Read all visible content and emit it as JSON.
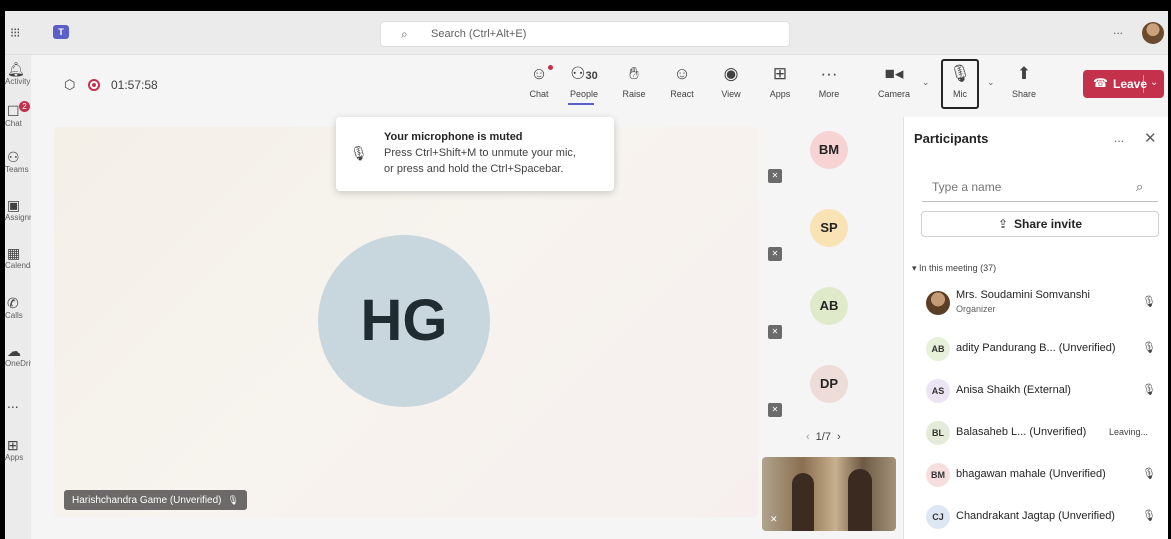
{
  "titlebar": {
    "search_placeholder": "Search (Ctrl+Alt+E)",
    "more": "..."
  },
  "rail": {
    "items": [
      {
        "label": "Activity",
        "icon": "bell-icon"
      },
      {
        "label": "Chat",
        "icon": "chat-icon",
        "badge": "2"
      },
      {
        "label": "Teams",
        "icon": "teams-icon"
      },
      {
        "label": "Assignments",
        "icon": "assignments-icon"
      },
      {
        "label": "Calendar",
        "icon": "calendar-icon"
      },
      {
        "label": "Calls",
        "icon": "phone-icon"
      },
      {
        "label": "OneDrive",
        "icon": "cloud-icon"
      },
      {
        "label": "...",
        "icon": "more-icon"
      },
      {
        "label": "Apps",
        "icon": "add-apps-icon"
      }
    ]
  },
  "toolbar": {
    "timer": "01:57:58",
    "chat": "Chat",
    "people": "People",
    "people_count": "30",
    "raise": "Raise",
    "react": "React",
    "view": "View",
    "apps": "Apps",
    "more": "More",
    "camera": "Camera",
    "mic": "Mic",
    "share": "Share",
    "leave": "Leave"
  },
  "toast": {
    "title": "Your microphone is muted",
    "line1": "Press Ctrl+Shift+M to unmute your mic,",
    "line2": "or press and hold the Ctrl+Spacebar."
  },
  "stage": {
    "initials": "HG",
    "name_tag": "Harishchandra Game (Unverified)"
  },
  "tiles": [
    {
      "initials": "BM",
      "color": "#f7d3d3"
    },
    {
      "initials": "SP",
      "color": "#f9e3b4"
    },
    {
      "initials": "AB",
      "color": "#dfeacb"
    },
    {
      "initials": "DP",
      "color": "#eddcd8"
    }
  ],
  "pager": {
    "text": "1/7"
  },
  "panel": {
    "title": "Participants",
    "more": "...",
    "search_placeholder": "Type a name",
    "share_invite": "Share invite",
    "in_meeting": "In this meeting (37)",
    "participants": [
      {
        "initials": "",
        "name": "Mrs. Soudamini Somvanshi",
        "sub": "Organizer",
        "photo": true,
        "avatar_color": "",
        "status": ""
      },
      {
        "initials": "AB",
        "name": "adity Pandurang B... (Unverified)",
        "sub": "",
        "photo": false,
        "avatar_color": "#e7f0d8",
        "status": ""
      },
      {
        "initials": "AS",
        "name": "Anisa Shaikh (External)",
        "sub": "",
        "photo": false,
        "avatar_color": "#ece3f3",
        "status": ""
      },
      {
        "initials": "BL",
        "name": "Balasaheb L... (Unverified)",
        "sub": "",
        "photo": false,
        "avatar_color": "#e4ecd9",
        "status": "Leaving..."
      },
      {
        "initials": "BM",
        "name": "bhagawan mahale (Unverified)",
        "sub": "",
        "photo": false,
        "avatar_color": "#f7dede",
        "status": ""
      },
      {
        "initials": "CJ",
        "name": "Chandrakant Jagtap (Unverified)",
        "sub": "",
        "photo": false,
        "avatar_color": "#dde6f3",
        "status": ""
      }
    ]
  },
  "colors": {
    "accent": "#5b5fc7",
    "leave": "#c4314b",
    "record": "#c4314b"
  }
}
